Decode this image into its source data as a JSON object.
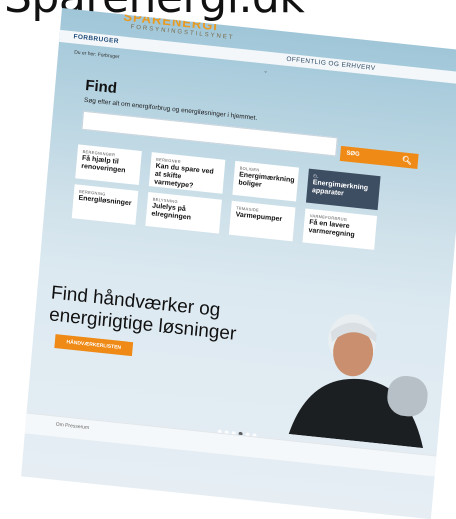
{
  "page_title": "Sparenergi.dk",
  "logo": {
    "text": "SPARENERGI",
    "sub": "FORSYNINGSTILSYNET"
  },
  "tabs": {
    "active": "FORBRUGER",
    "right": "OFFENTLIG OG ERHVERV"
  },
  "breadcrumb": [
    "Du er her:",
    "Forbruger"
  ],
  "find": {
    "title": "Find",
    "subtitle": "Søg efter alt om energiforbrug og energiløsninger i hjemmet.",
    "search_placeholder": "",
    "button_label": "SØG"
  },
  "cards": [
    {
      "cat": "BEREGNINGER",
      "title": "Få hjælp til renoveringen"
    },
    {
      "cat": "BEREGNER",
      "title": "Kan du spare ved at skifte varmetype?"
    },
    {
      "cat": "BOLIGEN",
      "title": "Energimærkning boliger"
    },
    {
      "cat": "EL",
      "title": "Energimærkning apparater"
    },
    {
      "cat": "BEREGNING",
      "title": "Energiløsninger"
    },
    {
      "cat": "BELYSNING",
      "title": "Julelys på elregningen"
    },
    {
      "cat": "TEMASIDE",
      "title": "Varmepumper"
    },
    {
      "cat": "VARMEFORBRUG",
      "title": "Få en lavere varmeregning"
    }
  ],
  "hero": {
    "title": "Find håndværker og\nenergirigtige løsninger",
    "cta_label": "HÅNDVÆRKERLISTEN"
  },
  "footer": {
    "text": "Om   Presserum"
  },
  "colors": {
    "accent": "#ef8a17",
    "dark_card": "#3e4e62"
  }
}
